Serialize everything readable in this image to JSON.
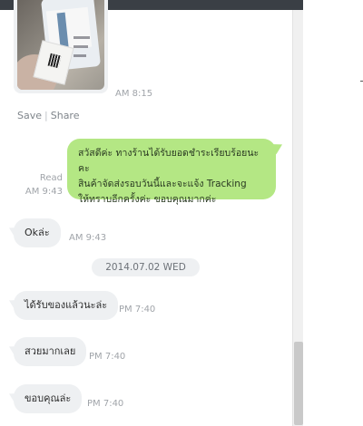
{
  "messages": {
    "photo": {
      "time": "AM 8:15",
      "save_label": "Save",
      "share_label": "Share"
    },
    "outgoing": {
      "read_label": "Read",
      "time": "AM 9:43",
      "lines": [
        "สวัสดีค่ะ ทางร้านได้รับยอดชำระเรียบร้อยนะคะ",
        "สินค้าจัดส่งรอบวันนี้และจะแจ้ง Tracking",
        "ให้ทราบอีกครั้งค่ะ ขอบคุณมากค่ะ"
      ]
    },
    "incoming_1": {
      "text": "Okล่ะ",
      "time": "AM 9:43"
    },
    "date_separator": "2014.07.02 WED",
    "incoming_2": {
      "text": "ได้รับของแล้วนะล่ะ",
      "time": "PM 7:40"
    },
    "incoming_3": {
      "text": "สวยมากเลย",
      "time": "PM 7:40"
    },
    "incoming_4": {
      "text": "ขอบคุณล่ะ",
      "time": "PM 7:40"
    }
  },
  "colors": {
    "outgoing_bubble": "#b4e784",
    "incoming_bubble": "#eef0f2",
    "topbar": "#3a3f45"
  }
}
